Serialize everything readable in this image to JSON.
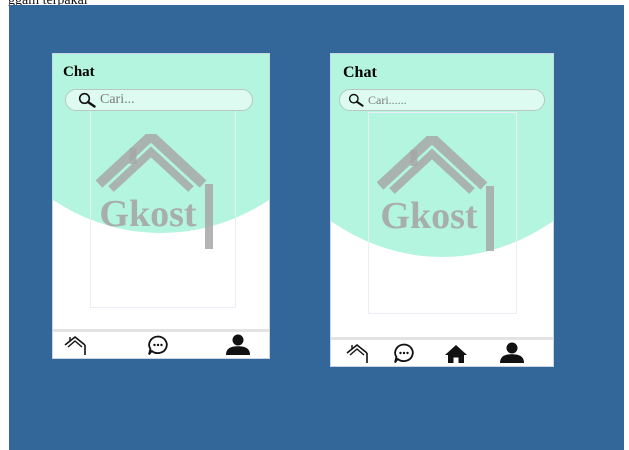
{
  "caption": "ggam terpakai",
  "colors": {
    "background": "#336699",
    "header_mint": "#b3f5df",
    "watermark": "#a7a7a7"
  },
  "screens": [
    {
      "title": "Chat",
      "search_placeholder": "Cari...",
      "logo_text": "Gkost",
      "nav": [
        "home-outline-icon",
        "chat-bubble-icon",
        "user-profile-icon"
      ]
    },
    {
      "title": "Chat",
      "search_placeholder": "Cari......",
      "logo_text": "Gkost",
      "nav": [
        "home-outline-icon",
        "chat-bubble-icon",
        "home-filled-icon",
        "user-profile-icon"
      ]
    }
  ]
}
